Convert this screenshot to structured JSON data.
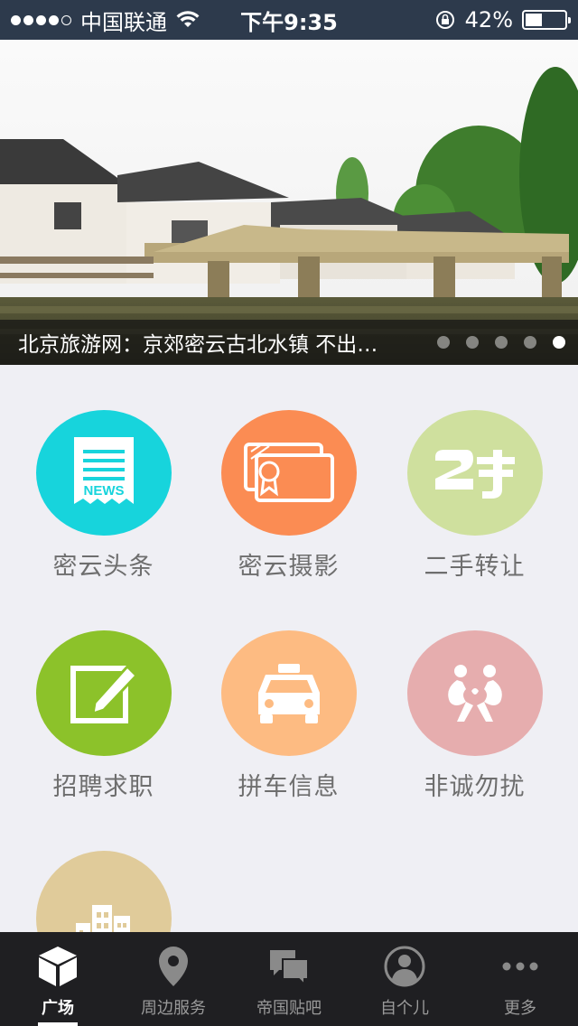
{
  "status_bar": {
    "carrier": "中国联通",
    "time": "下午9:35",
    "battery": "42%",
    "battery_level": 0.42
  },
  "banner": {
    "caption": "北京旅游网：京郊密云古北水镇 不出…",
    "dot_count": 5,
    "active_dot": 5
  },
  "tiles": [
    {
      "label": "密云头条",
      "color": "#17d4dc",
      "icon": "news-icon"
    },
    {
      "label": "密云摄影",
      "color": "#fb8c53",
      "icon": "certificate-icon"
    },
    {
      "label": "二手转让",
      "color": "#cfe09e",
      "icon": "secondhand-icon"
    },
    {
      "label": "招聘求职",
      "color": "#8cc22a",
      "icon": "edit-icon"
    },
    {
      "label": "拼车信息",
      "color": "#fdbb82",
      "icon": "taxi-icon"
    },
    {
      "label": "非诚勿扰",
      "color": "#e6adae",
      "icon": "couple-icon"
    },
    {
      "label": "",
      "color": "#e0cb9a",
      "icon": "buildings-icon"
    }
  ],
  "tabs": [
    {
      "label": "广场",
      "icon": "cube-icon",
      "active": true
    },
    {
      "label": "周边服务",
      "icon": "location-pin-icon",
      "active": false
    },
    {
      "label": "帝国贴吧",
      "icon": "chat-bubbles-icon",
      "active": false
    },
    {
      "label": "自个儿",
      "icon": "user-avatar-icon",
      "active": false
    },
    {
      "label": "更多",
      "icon": "more-dots-icon",
      "active": false
    }
  ]
}
